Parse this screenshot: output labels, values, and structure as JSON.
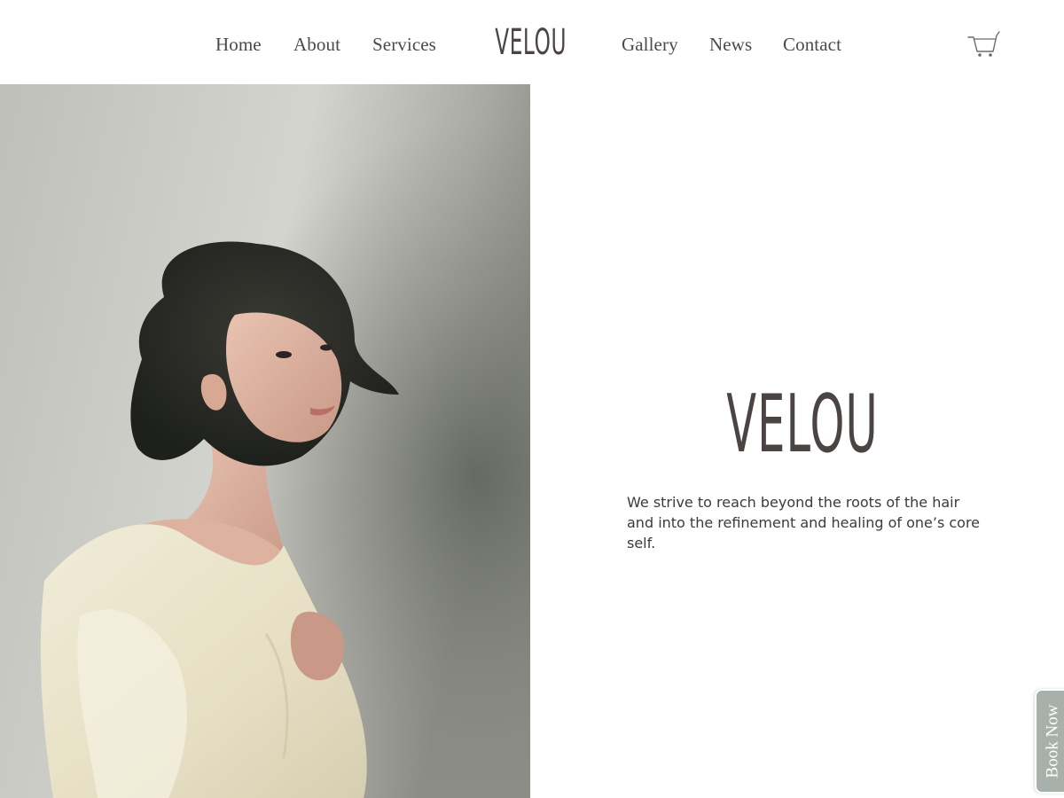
{
  "header": {
    "nav_left": [
      "Home",
      "About",
      "Services"
    ],
    "nav_right": [
      "Gallery",
      "News",
      "Contact"
    ],
    "logo_text": "VELOU",
    "cart_icon": "shopping-cart-icon"
  },
  "hero": {
    "image": "portrait-photo",
    "brand_name": "VELOU",
    "tagline": "We strive to reach beyond the roots of the hair and into the refinement and healing of one’s core self."
  },
  "book_now": {
    "label": "Book Now"
  },
  "colors": {
    "text": "#4a4543",
    "book_now_bg": "#a8b0ab",
    "background": "#ffffff"
  }
}
